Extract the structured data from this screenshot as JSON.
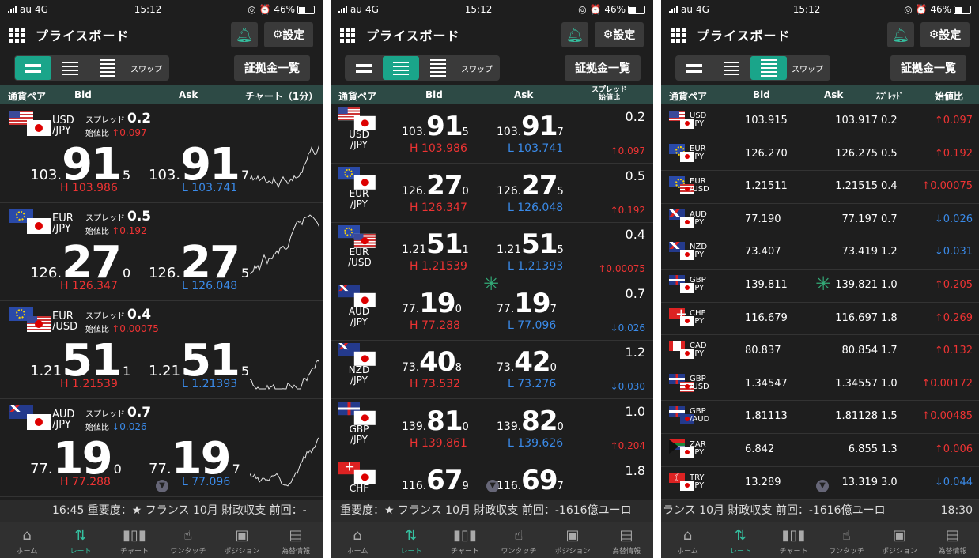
{
  "status": {
    "carrier": "au",
    "network": "4G",
    "time": "15:12",
    "battery": "46%",
    "icons": "◎ ⏰"
  },
  "header": {
    "title": "プライスボード",
    "settings_label": "設定",
    "bell_icon": "bell-icon"
  },
  "toolbar": {
    "swap_label": "スワップ",
    "margin_label": "証拠金一覧"
  },
  "p1_cols": {
    "pair": "通貨ペア",
    "bid": "Bid",
    "ask": "Ask",
    "chart": "チャート（1分）"
  },
  "p2_cols": {
    "pair": "通貨ペア",
    "bid": "Bid",
    "ask": "Ask",
    "spread": "スプレッド",
    "open": "始値比"
  },
  "p3_cols": {
    "pair": "通貨ペア",
    "bid": "Bid",
    "ask": "Ask",
    "spread": "ｽﾌﾟﾚｯﾄﾞ",
    "open": "始値比"
  },
  "labels": {
    "spread": "スプレッド",
    "open": "始値比"
  },
  "p1_cards": [
    {
      "pair1": "USD",
      "pair2": "/JPY",
      "spread": "0.2",
      "arrow": "↑",
      "dir": "up",
      "change": "0.097",
      "bid_a": "103.",
      "bid_b": "91",
      "bid_c": "5",
      "ask_a": "103.",
      "ask_b": "91",
      "ask_c": "7",
      "high": "H 103.986",
      "low": "L 103.741"
    },
    {
      "pair1": "EUR",
      "pair2": "/JPY",
      "spread": "0.5",
      "arrow": "↑",
      "dir": "up",
      "change": "0.192",
      "bid_a": "126.",
      "bid_b": "27",
      "bid_c": "0",
      "ask_a": "126.",
      "ask_b": "27",
      "ask_c": "5",
      "high": "H 126.347",
      "low": "L 126.048"
    },
    {
      "pair1": "EUR",
      "pair2": "/USD",
      "spread": "0.4",
      "arrow": "↑",
      "dir": "up",
      "change": "0.00075",
      "bid_a": "1.21",
      "bid_b": "51",
      "bid_c": "1",
      "ask_a": "1.21",
      "ask_b": "51",
      "ask_c": "5",
      "high": "H 1.21539",
      "low": "L 1.21393"
    },
    {
      "pair1": "AUD",
      "pair2": "/JPY",
      "spread": "0.7",
      "arrow": "↓",
      "dir": "dn",
      "change": "0.026",
      "bid_a": "77.",
      "bid_b": "19",
      "bid_c": "0",
      "ask_a": "77.",
      "ask_b": "19",
      "ask_c": "7",
      "high": "H 77.288",
      "low": "L 77.096"
    }
  ],
  "p2_rows": [
    {
      "pair1": "USD",
      "pair2": "/JPY",
      "bid_a": "103.",
      "bid_b": "91",
      "bid_c": "5",
      "ask_a": "103.",
      "ask_b": "91",
      "ask_c": "7",
      "high": "H 103.986",
      "low": "L 103.741",
      "spread": "0.2",
      "arrow": "↑",
      "dir": "up",
      "change": "0.097"
    },
    {
      "pair1": "EUR",
      "pair2": "/JPY",
      "bid_a": "126.",
      "bid_b": "27",
      "bid_c": "0",
      "ask_a": "126.",
      "ask_b": "27",
      "ask_c": "5",
      "high": "H 126.347",
      "low": "L 126.048",
      "spread": "0.5",
      "arrow": "↑",
      "dir": "up",
      "change": "0.192"
    },
    {
      "pair1": "EUR",
      "pair2": "/USD",
      "bid_a": "1.21",
      "bid_b": "51",
      "bid_c": "1",
      "ask_a": "1.21",
      "ask_b": "51",
      "ask_c": "5",
      "high": "H 1.21539",
      "low": "L 1.21393",
      "spread": "0.4",
      "arrow": "↑",
      "dir": "up",
      "change": "0.00075"
    },
    {
      "pair1": "AUD",
      "pair2": "/JPY",
      "bid_a": "77.",
      "bid_b": "19",
      "bid_c": "0",
      "ask_a": "77.",
      "ask_b": "19",
      "ask_c": "7",
      "high": "H 77.288",
      "low": "L 77.096",
      "spread": "0.7",
      "arrow": "↓",
      "dir": "dn",
      "change": "0.026"
    },
    {
      "pair1": "NZD",
      "pair2": "/JPY",
      "bid_a": "73.",
      "bid_b": "40",
      "bid_c": "8",
      "ask_a": "73.",
      "ask_b": "42",
      "ask_c": "0",
      "high": "H 73.532",
      "low": "L 73.276",
      "spread": "1.2",
      "arrow": "↓",
      "dir": "dn",
      "change": "0.030"
    },
    {
      "pair1": "GBP",
      "pair2": "/JPY",
      "bid_a": "139.",
      "bid_b": "81",
      "bid_c": "0",
      "ask_a": "139.",
      "ask_b": "82",
      "ask_c": "0",
      "high": "H 139.861",
      "low": "L 139.626",
      "spread": "1.0",
      "arrow": "↑",
      "dir": "up",
      "change": "0.204"
    },
    {
      "pair1": "CHF",
      "pair2": "",
      "bid_a": "116.",
      "bid_b": "67",
      "bid_c": "9",
      "ask_a": "116.",
      "ask_b": "69",
      "ask_c": "7",
      "high": "",
      "low": "",
      "spread": "1.8",
      "arrow": "",
      "dir": "up",
      "change": ""
    }
  ],
  "p3_rows": [
    {
      "pair1": "USD",
      "pair2": "/JPY",
      "bid": "103.915",
      "ask": "103.917",
      "spread": "0.2",
      "arrow": "↑",
      "dir": "up",
      "change": "0.097"
    },
    {
      "pair1": "EUR",
      "pair2": "/JPY",
      "bid": "126.270",
      "ask": "126.275",
      "spread": "0.5",
      "arrow": "↑",
      "dir": "up",
      "change": "0.192"
    },
    {
      "pair1": "EUR",
      "pair2": "/USD",
      "bid": "1.21511",
      "ask": "1.21515",
      "spread": "0.4",
      "arrow": "↑",
      "dir": "up",
      "change": "0.00075"
    },
    {
      "pair1": "AUD",
      "pair2": "/JPY",
      "bid": "77.190",
      "ask": "77.197",
      "spread": "0.7",
      "arrow": "↓",
      "dir": "dn",
      "change": "0.026"
    },
    {
      "pair1": "NZD",
      "pair2": "/JPY",
      "bid": "73.407",
      "ask": "73.419",
      "spread": "1.2",
      "arrow": "↓",
      "dir": "dn",
      "change": "0.031"
    },
    {
      "pair1": "GBP",
      "pair2": "/JPY",
      "bid": "139.811",
      "ask": "139.821",
      "spread": "1.0",
      "arrow": "↑",
      "dir": "up",
      "change": "0.205"
    },
    {
      "pair1": "CHF",
      "pair2": "/JPY",
      "bid": "116.679",
      "ask": "116.697",
      "spread": "1.8",
      "arrow": "↑",
      "dir": "up",
      "change": "0.269"
    },
    {
      "pair1": "CAD",
      "pair2": "/JPY",
      "bid": "80.837",
      "ask": "80.854",
      "spread": "1.7",
      "arrow": "↑",
      "dir": "up",
      "change": "0.132"
    },
    {
      "pair1": "GBP",
      "pair2": "/USD",
      "bid": "1.34547",
      "ask": "1.34557",
      "spread": "1.0",
      "arrow": "↑",
      "dir": "up",
      "change": "0.00172"
    },
    {
      "pair1": "GBP",
      "pair2": "/AUD",
      "bid": "1.81113",
      "ask": "1.81128",
      "spread": "1.5",
      "arrow": "↑",
      "dir": "up",
      "change": "0.00485"
    },
    {
      "pair1": "ZAR",
      "pair2": "/JPY",
      "bid": "6.842",
      "ask": "6.855",
      "spread": "1.3",
      "arrow": "↑",
      "dir": "up",
      "change": "0.006"
    },
    {
      "pair1": "TRY",
      "pair2": "/JPY",
      "bid": "13.289",
      "ask": "13.319",
      "spread": "3.0",
      "arrow": "↓",
      "dir": "dn",
      "change": "0.044"
    }
  ],
  "tickers": {
    "p1": "16:45 重要度：★ フランス 10月 財政収支 前回：-",
    "p2": "重要度：★ フランス 10月 財政収支 前回：-1616億ユーロ",
    "p3": "ランス 10月 財政収支 前回：-1616億ユーロ",
    "p3_time": "18:30"
  },
  "nav": [
    {
      "label": "ホーム",
      "icon": "home-icon",
      "glyph": "⌂"
    },
    {
      "label": "レート",
      "icon": "rate-icon",
      "glyph": "⇅"
    },
    {
      "label": "チャート",
      "icon": "chart-icon",
      "glyph": "▮▯▮"
    },
    {
      "label": "ワンタッチ",
      "icon": "one-touch-icon",
      "glyph": "☝"
    },
    {
      "label": "ポジション",
      "icon": "position-icon",
      "glyph": "▣"
    },
    {
      "label": "為替情報",
      "icon": "news-icon",
      "glyph": "▤"
    }
  ],
  "colors": {
    "accent": "#1aa58a",
    "up": "#e33333",
    "down": "#3a8ae8",
    "header_row": "#2d4a45"
  }
}
